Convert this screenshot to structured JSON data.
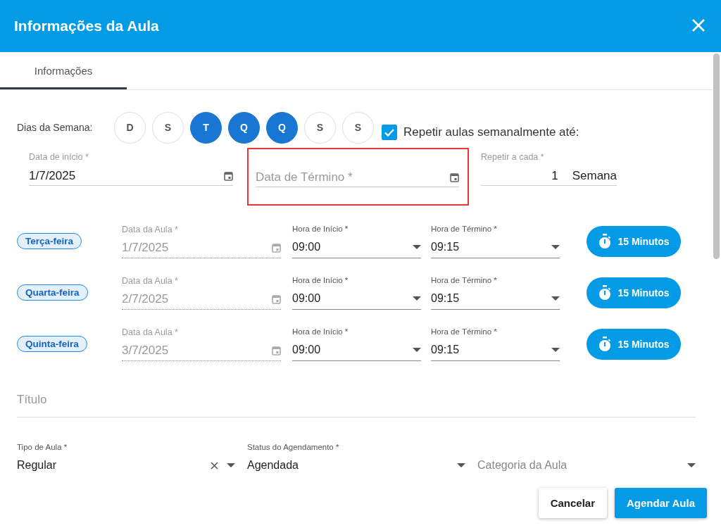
{
  "window": {
    "title": "Informações da Aula"
  },
  "tabs": [
    {
      "label": "Informações",
      "selected": true
    }
  ],
  "weekdays": {
    "label": "Dias da Semana:",
    "days": [
      {
        "letter": "D",
        "selected": false
      },
      {
        "letter": "S",
        "selected": false
      },
      {
        "letter": "T",
        "selected": true
      },
      {
        "letter": "Q",
        "selected": true
      },
      {
        "letter": "Q",
        "selected": true
      },
      {
        "letter": "S",
        "selected": false
      },
      {
        "letter": "S",
        "selected": false
      }
    ]
  },
  "repeat_checkbox": {
    "label": "Repetir aulas semanalmente até:",
    "checked": true
  },
  "start_date": {
    "label": "Data de início *",
    "value": "1/7/2025"
  },
  "end_date": {
    "placeholder": "Data de Término *",
    "highlighted": true
  },
  "repeat_every": {
    "label": "Repetir a cada *",
    "value": "1",
    "unit": "Semana"
  },
  "classes": [
    {
      "day": "Terça-feira",
      "date_label": "Data da Aula *",
      "date": "1/7/2025",
      "date_disabled": true,
      "start_label": "Hora de Início *",
      "start": "09:00",
      "end_label": "Hora de Término *",
      "end": "09:15",
      "duration": "15 Minutos"
    },
    {
      "day": "Quarta-feira",
      "date_label": "Data da Aula *",
      "date": "2/7/2025",
      "date_disabled": true,
      "start_label": "Hora de Início *",
      "start": "09:00",
      "end_label": "Hora de Término *",
      "end": "09:15",
      "duration": "15 Minutos"
    },
    {
      "day": "Quinta-feira",
      "date_label": "Data da Aula *",
      "date": "3/7/2025",
      "date_disabled": true,
      "start_label": "Hora de Início *",
      "start": "09:00",
      "end_label": "Hora de Término *",
      "end": "09:15",
      "duration": "15 Minutos"
    }
  ],
  "title_field": {
    "placeholder": "Título"
  },
  "selects": [
    {
      "label": "Tipo de Aula *",
      "value": "Regular",
      "clearable": true
    },
    {
      "label": "Status do Agendamento *",
      "value": "Agendada",
      "clearable": false
    },
    {
      "placeholder": "Categoria da Aula",
      "clearable": false
    }
  ],
  "buttons": [
    {
      "label": "Cancelar",
      "kind": "secondary"
    },
    {
      "label": "Agendar Aula",
      "kind": "primary"
    }
  ]
}
